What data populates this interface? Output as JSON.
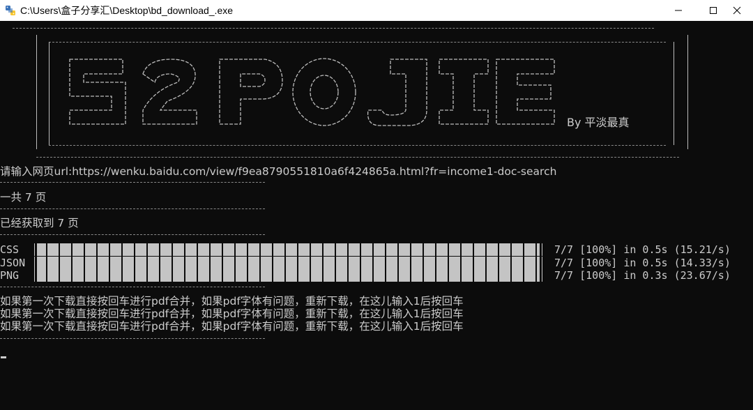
{
  "window": {
    "title": "C:\\Users\\盒子分享汇\\Desktop\\bd_download_.exe",
    "icon": "python-app-icon",
    "controls": [
      "minimize-icon",
      "maximize-icon",
      "close-icon"
    ]
  },
  "banner": {
    "logo_text": "52POJIE",
    "byline": "By 平淡最真"
  },
  "console": {
    "url_prompt": "请输入网页url:https://wenku.baidu.com/view/f9ea8790551810a6f424865a.html?fr=income1-doc-search",
    "total_pages": "一共 7 页",
    "fetched_pages": "已经获取到 7 页",
    "progress": [
      {
        "label": "CSS",
        "stat": "7/7 [100%] in 0.5s (15.21/s)",
        "fraction": 1.0
      },
      {
        "label": "JSON",
        "stat": "7/7 [100%] in 0.5s (14.33/s)",
        "fraction": 1.0
      },
      {
        "label": "PNG",
        "stat": "7/7 [100%] in 0.3s (23.67/s)",
        "fraction": 1.0
      }
    ],
    "messages": [
      "如果第一次下载直接按回车进行pdf合并，如果pdf字体有问题，重新下载，在这儿输入1后按回车",
      "如果第一次下载直接按回车进行pdf合并，如果pdf字体有问题，重新下载，在这儿输入1后按回车",
      "如果第一次下载直接按回车进行pdf合并，如果pdf字体有问题，重新下载，在这儿输入1后按回车"
    ]
  },
  "colors": {
    "console_bg": "#0c0c0c",
    "console_text": "#cccccc",
    "titlebar_bg": "#ffffff"
  }
}
